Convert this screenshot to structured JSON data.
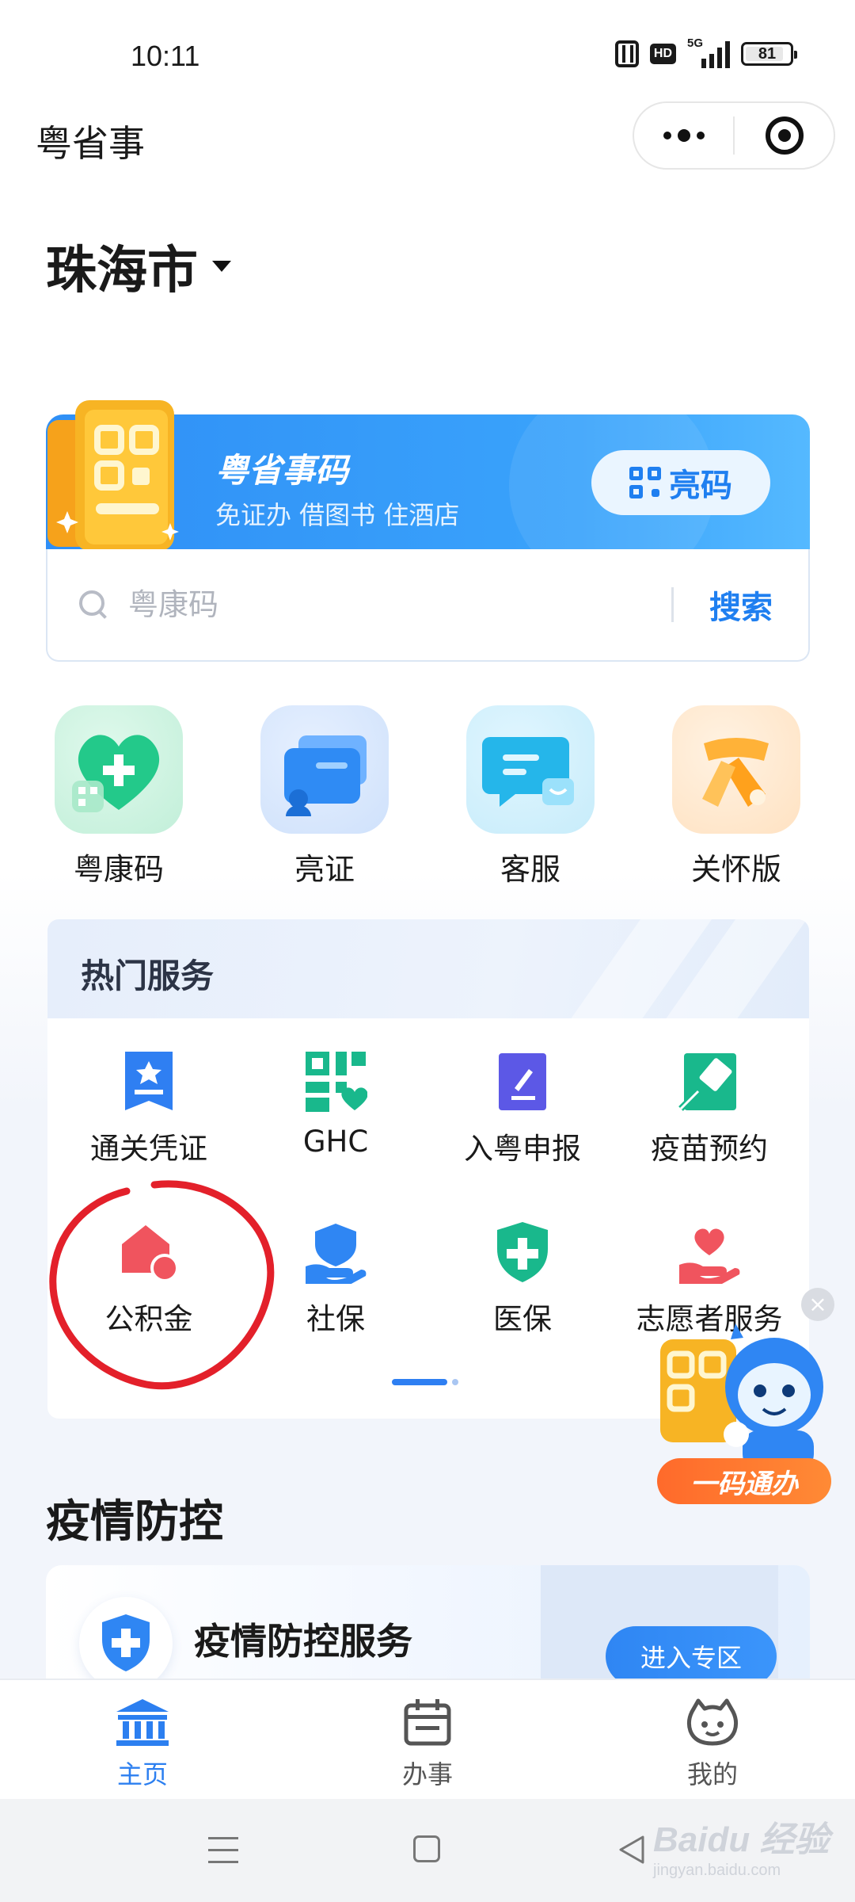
{
  "status_bar": {
    "time": "10:11",
    "network": "5G",
    "hd": "HD",
    "battery": "81"
  },
  "header": {
    "title": "粤省事"
  },
  "city": {
    "name": "珠海市"
  },
  "code_banner": {
    "title": "粤省事码",
    "subtitle": "免证办 借图书 住酒店",
    "button_label": "亮码"
  },
  "search": {
    "placeholder": "粤康码",
    "button_label": "搜索"
  },
  "quick_actions": [
    {
      "label": "粤康码",
      "icon": "health-code-heart-icon"
    },
    {
      "label": "亮证",
      "icon": "id-cards-icon"
    },
    {
      "label": "客服",
      "icon": "chat-bubble-icon"
    },
    {
      "label": "关怀版",
      "icon": "scarf-icon"
    }
  ],
  "hot_services": {
    "title": "热门服务",
    "items": [
      {
        "label": "通关凭证",
        "icon": "customs-certificate-icon",
        "color": "#2f7ff2"
      },
      {
        "label": "GHC",
        "icon": "ghc-qr-heart-icon",
        "color": "#19b88c"
      },
      {
        "label": "入粤申报",
        "icon": "declaration-pen-icon",
        "color": "#5c58e6"
      },
      {
        "label": "疫苗预约",
        "icon": "vaccine-syringe-icon",
        "color": "#19b88c"
      },
      {
        "label": "公积金",
        "icon": "housing-fund-house-icon",
        "color": "#f0545e"
      },
      {
        "label": "社保",
        "icon": "social-security-hand-icon",
        "color": "#2f86f3"
      },
      {
        "label": "医保",
        "icon": "medical-insurance-shield-icon",
        "color": "#19b88c"
      },
      {
        "label": "志愿者服务",
        "icon": "volunteer-heart-hand-icon",
        "color": "#f0545e"
      }
    ],
    "page_indicator": {
      "current": 1,
      "total": 2
    }
  },
  "floating_widget": {
    "label": "一码通办"
  },
  "epidemic": {
    "section_title": "疫情防控",
    "card_title": "疫情防控服务",
    "button_label": "进入专区"
  },
  "tabbar": {
    "items": [
      {
        "label": "主页",
        "active": true
      },
      {
        "label": "办事",
        "active": false
      },
      {
        "label": "我的",
        "active": false
      }
    ]
  },
  "watermark": {
    "brand": "Baidu 经验",
    "url": "jingyan.baidu.com"
  },
  "colors": {
    "primary": "#2c7ff0",
    "annotation_red": "#e3202a"
  }
}
